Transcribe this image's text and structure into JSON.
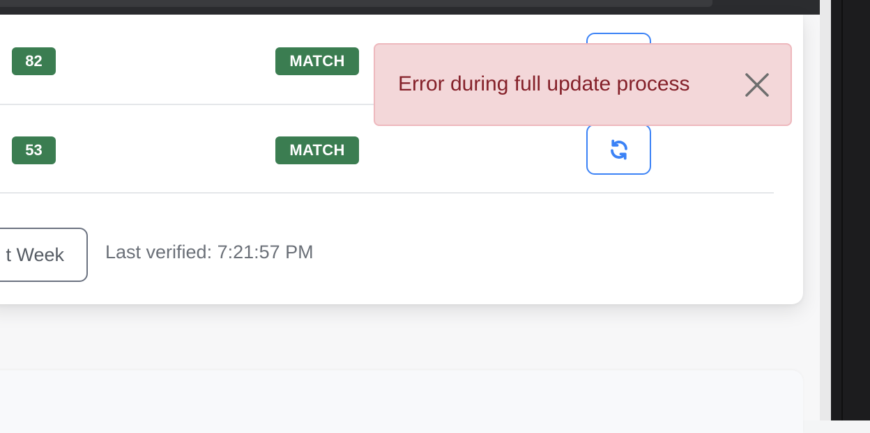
{
  "table": {
    "rows": [
      {
        "score": "82",
        "status": "MATCH"
      },
      {
        "score": "53",
        "status": "MATCH"
      }
    ]
  },
  "footer": {
    "week_button_label": "t Week",
    "last_verified": "Last verified: 7:21:57 PM"
  },
  "toast": {
    "message": "Error during full update process",
    "close_icon": "close-icon"
  },
  "icons": {
    "refresh": "refresh-icon"
  },
  "colors": {
    "match_badge": "#3b7d51",
    "refresh_accent": "#3b82f6",
    "toast_background": "#f3d7d9",
    "toast_text": "#842029"
  }
}
